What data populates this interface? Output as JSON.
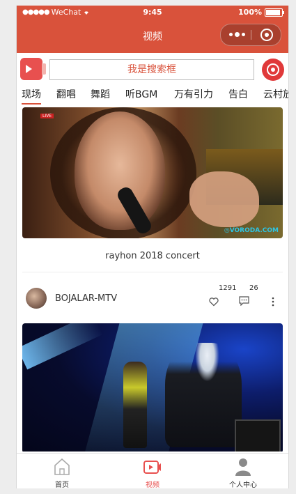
{
  "status_bar": {
    "signal_dots": "●●●●●",
    "carrier": "WeChat",
    "time": "9:45",
    "battery": "100%"
  },
  "nav": {
    "title": "视频"
  },
  "search": {
    "placeholder": "我是搜索框"
  },
  "tabs": [
    "现场",
    "翻唱",
    "舞蹈",
    "听BGM",
    "万有引力",
    "告白",
    "云村放映厅"
  ],
  "feed": {
    "video1": {
      "badge": "LIVE",
      "watermark": "◎VORODA.COM",
      "caption": "rayhon 2018 concert"
    },
    "video2_meta": {
      "author": "BOJALAR-MTV",
      "likes": "1291",
      "comments": "26"
    }
  },
  "tabbar": {
    "items": [
      {
        "label": "首页",
        "icon": "home-icon"
      },
      {
        "label": "视频",
        "icon": "video-icon",
        "active": true
      },
      {
        "label": "个人中心",
        "icon": "user-icon"
      }
    ]
  },
  "colors": {
    "brand": "#d9523b",
    "accent": "#e8504f"
  }
}
